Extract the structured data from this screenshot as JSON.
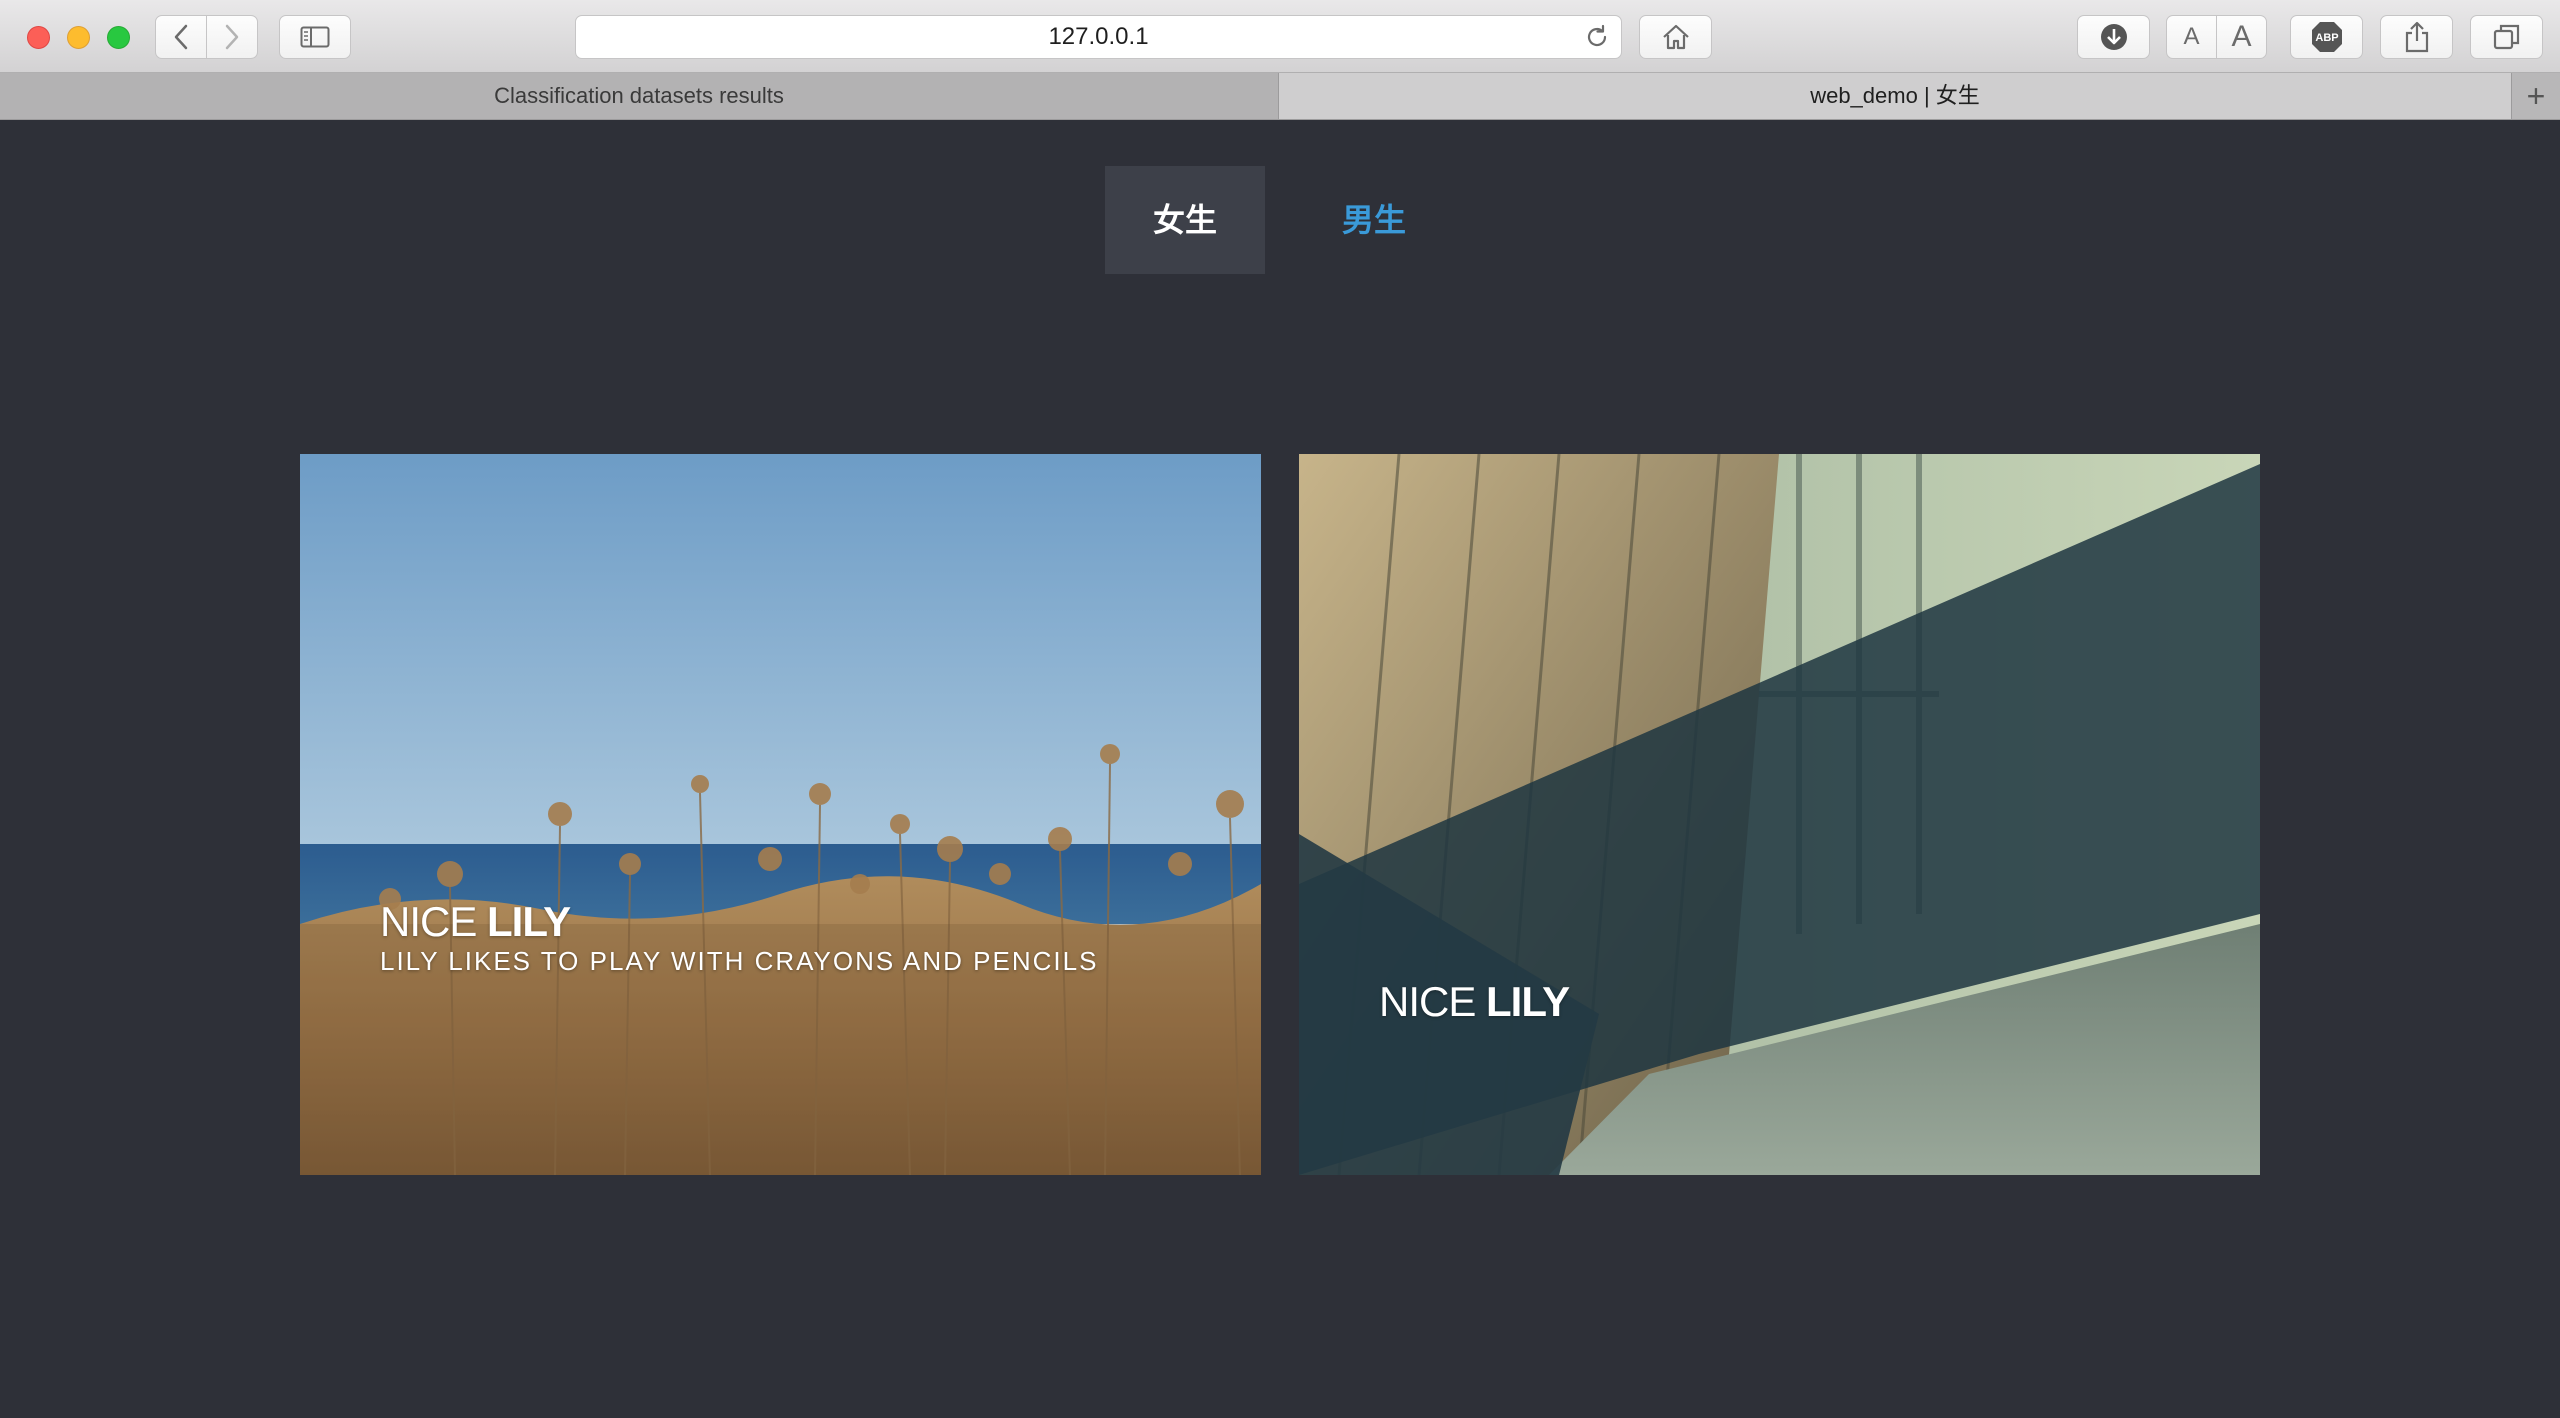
{
  "browser": {
    "address_url": "127.0.0.1",
    "font_small_label": "A",
    "font_large_label": "A",
    "adblock_label": "ABP",
    "new_tab_label": "+",
    "tabs": [
      {
        "label": "Classification datasets results"
      },
      {
        "label": "web_demo | 女生"
      }
    ]
  },
  "page": {
    "gender_tabs": [
      {
        "label": "女生",
        "active": true
      },
      {
        "label": "男生",
        "active": false
      }
    ],
    "cards": [
      {
        "title_light": "NICE",
        "title_bold": "LILY",
        "subtitle": "LILY LIKES TO PLAY WITH CRAYONS AND PENCILS",
        "image": "field-of-dried-flowers-by-the-sea"
      },
      {
        "title_light": "NICE",
        "title_bold": "LILY",
        "image": "row-of-chairs-by-window"
      }
    ]
  },
  "colors": {
    "page_background": "#2e3038",
    "active_tab_background": "#3d4049",
    "link_blue": "#3a9ad9"
  }
}
